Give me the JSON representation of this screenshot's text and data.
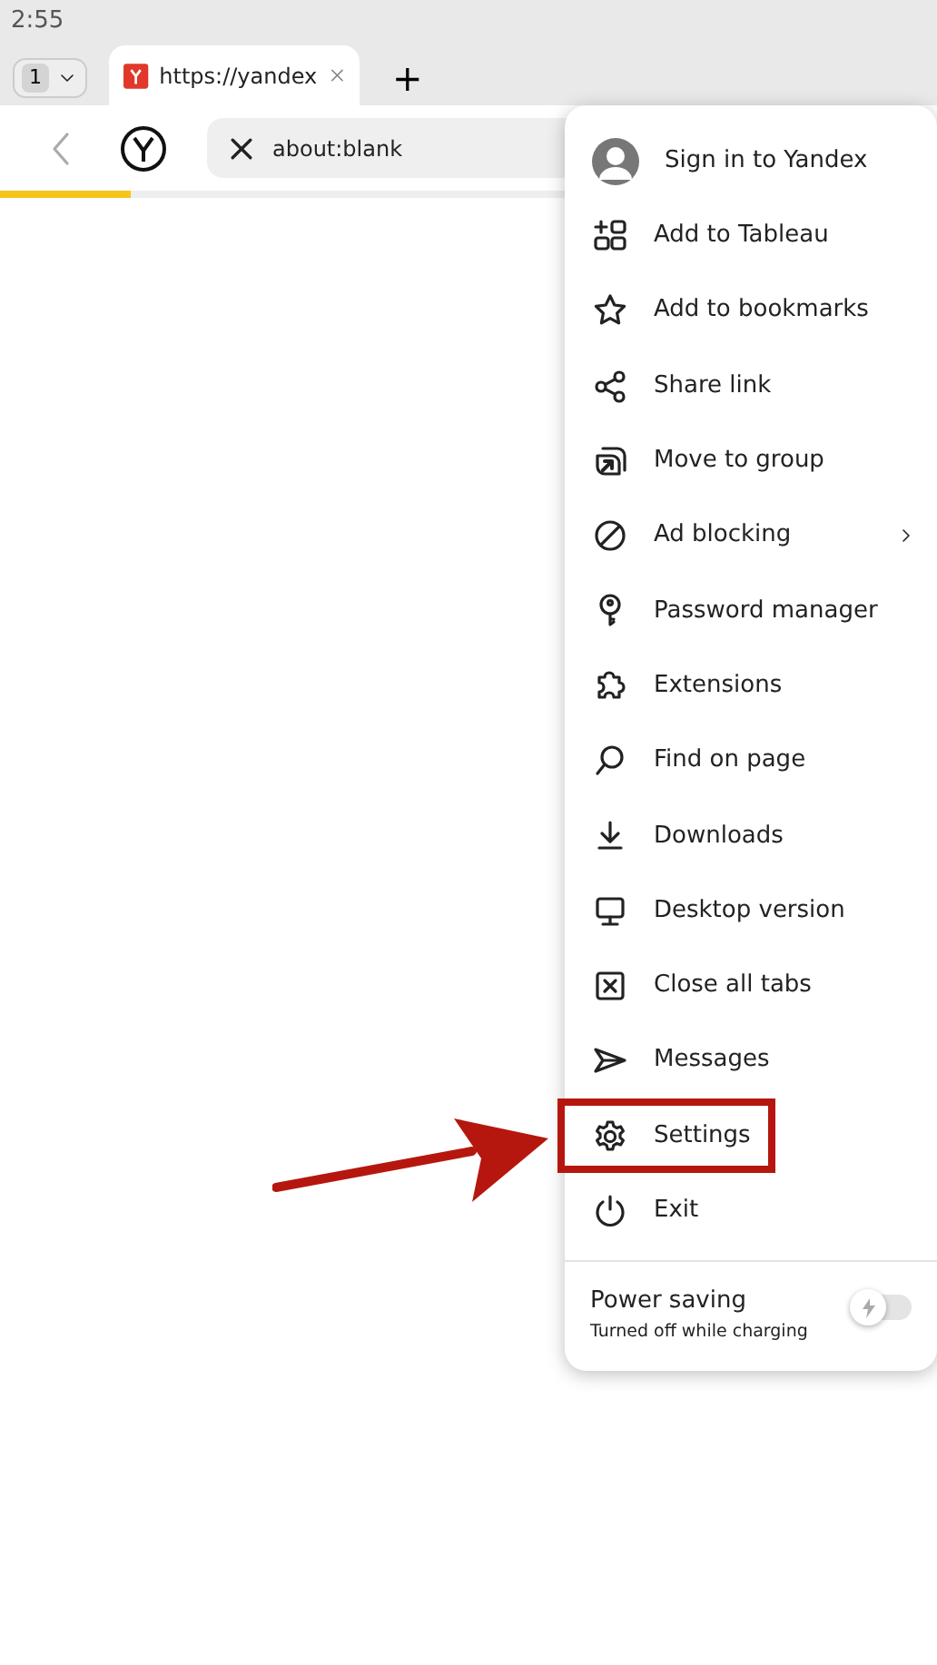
{
  "status_bar": {
    "time": "2:55"
  },
  "tab_strip": {
    "tab_count": "1",
    "tabs": [
      {
        "title": "https://yandex",
        "selected": true
      }
    ],
    "new_tab": "+"
  },
  "toolbar": {
    "address": "about:blank",
    "loading": {
      "level": 0.14
    }
  },
  "menu": {
    "items": [
      {
        "kind": "account",
        "label": "Sign in to Yandex",
        "submenu": false,
        "highlighted": false
      },
      {
        "kind": "item",
        "label": "Add to Tableau",
        "submenu": false,
        "highlighted": false
      },
      {
        "kind": "item",
        "label": "Add to bookmarks",
        "submenu": false,
        "highlighted": false
      },
      {
        "kind": "item",
        "label": "Share link",
        "submenu": false,
        "highlighted": false
      },
      {
        "kind": "item",
        "label": "Move to group",
        "submenu": false,
        "highlighted": false
      },
      {
        "kind": "item",
        "label": "Ad blocking",
        "submenu": true,
        "highlighted": false
      },
      {
        "kind": "item",
        "label": "Password manager",
        "submenu": false,
        "highlighted": false
      },
      {
        "kind": "item",
        "label": "Extensions",
        "submenu": false,
        "highlighted": false
      },
      {
        "kind": "item",
        "label": "Find on page",
        "submenu": false,
        "highlighted": false
      },
      {
        "kind": "item",
        "label": "Downloads",
        "submenu": false,
        "highlighted": false
      },
      {
        "kind": "item",
        "label": "Desktop version",
        "submenu": false,
        "highlighted": false
      },
      {
        "kind": "item",
        "label": "Close all tabs",
        "submenu": false,
        "highlighted": false
      },
      {
        "kind": "item",
        "label": "Messages",
        "submenu": false,
        "highlighted": false
      },
      {
        "kind": "item",
        "label": "Settings",
        "submenu": false,
        "highlighted": true
      },
      {
        "kind": "item",
        "label": "Exit",
        "submenu": false,
        "highlighted": false
      }
    ],
    "power_saving": {
      "label": "Power saving",
      "note": "Turned off while charging",
      "on": false
    }
  }
}
